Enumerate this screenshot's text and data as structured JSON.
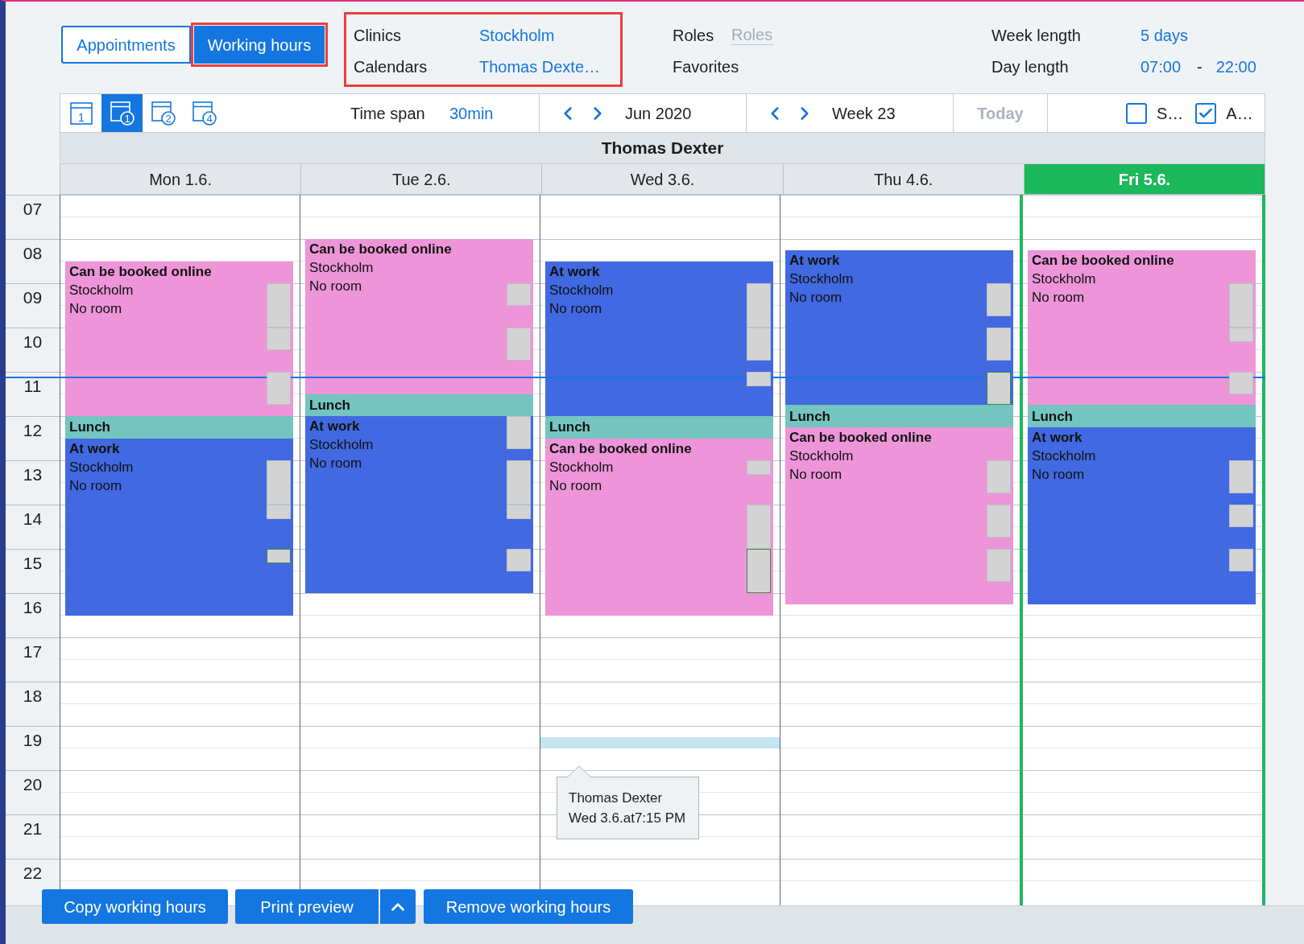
{
  "mode_tabs": [
    {
      "label": "Appointments",
      "selected": false,
      "highlighted": false
    },
    {
      "label": "Working hours",
      "selected": true,
      "highlighted": true
    }
  ],
  "filters": {
    "highlighted": true,
    "rows": [
      {
        "label": "Clinics",
        "value": "Stockholm"
      },
      {
        "label": "Calendars",
        "value": "Thomas Dexte…"
      }
    ]
  },
  "roles": {
    "label": "Roles",
    "placeholder": "Roles"
  },
  "favorites": {
    "label": "Favorites"
  },
  "week_length": {
    "label": "Week length",
    "value": "5 days"
  },
  "day_length": {
    "label": "Day length",
    "from": "07:00",
    "separator": "-",
    "to": "22:00"
  },
  "toolbar": {
    "view_buttons": [
      {
        "kind": "plain",
        "label": "1",
        "selected": false
      },
      {
        "kind": "badge",
        "label": "1",
        "selected": true
      },
      {
        "kind": "badge",
        "label": "2",
        "selected": false
      },
      {
        "kind": "badge",
        "label": "4",
        "selected": false
      }
    ],
    "time_span": {
      "label": "Time span",
      "value": "30min"
    },
    "month": "Jun 2020",
    "week": "Week 23",
    "today": {
      "label": "Today",
      "disabled": true
    },
    "checkboxes": [
      {
        "label": "S…",
        "checked": false
      },
      {
        "label": "A…",
        "checked": true
      }
    ]
  },
  "calendar": {
    "owner": "Thomas Dexter",
    "hours": [
      "07",
      "08",
      "09",
      "10",
      "11",
      "12",
      "13",
      "14",
      "15",
      "16",
      "17",
      "18",
      "19",
      "20",
      "21",
      "22"
    ],
    "days": [
      {
        "label": "Mon 1.6.",
        "selected": false,
        "events": [
          {
            "title": "Can be booked online",
            "location": "Stockholm",
            "room": "No room",
            "color": "#ed95d8",
            "slots": [
              {
                "selected": false
              },
              {
                "selected": false
              },
              {
                "selected": false
              }
            ]
          },
          {
            "title": "Lunch",
            "color": "#74c4c0"
          },
          {
            "title": "At work",
            "location": "Stockholm",
            "room": "No room",
            "color": "#4169e1",
            "slots": [
              {
                "selected": false
              },
              {
                "selected": false
              },
              {
                "selected": true
              }
            ]
          }
        ]
      },
      {
        "label": "Tue 2.6.",
        "selected": false,
        "events": [
          {
            "title": "Can be booked online",
            "location": "Stockholm",
            "room": "No room",
            "color": "#ed95d8",
            "slots": [
              {
                "selected": false
              },
              {
                "selected": false
              }
            ]
          },
          {
            "title": "Lunch",
            "color": "#74c4c0"
          },
          {
            "title": "At work",
            "location": "Stockholm",
            "room": "No room",
            "color": "#4169e1",
            "slots": [
              {
                "selected": false
              },
              {
                "selected": false
              },
              {
                "selected": false
              },
              {
                "selected": false
              }
            ]
          }
        ]
      },
      {
        "label": "Wed 3.6.",
        "selected": false,
        "tooltip": {
          "title": "Thomas Dexter",
          "time": "Wed 3.6.at7:15 PM"
        },
        "events": [
          {
            "title": "At work",
            "location": "Stockholm",
            "room": "No room",
            "color": "#4169e1",
            "slots": [
              {
                "selected": false
              },
              {
                "selected": false
              },
              {
                "selected": false
              }
            ]
          },
          {
            "title": "Lunch",
            "color": "#74c4c0"
          },
          {
            "title": "Can be booked online",
            "location": "Stockholm",
            "room": "No room",
            "color": "#ed95d8",
            "slots": [
              {
                "selected": false
              },
              {
                "selected": false
              },
              {
                "selected": true
              }
            ]
          }
        ]
      },
      {
        "label": "Thu 4.6.",
        "selected": false,
        "events": [
          {
            "title": "At work",
            "location": "Stockholm",
            "room": "No room",
            "color": "#4169e1",
            "slots": [
              {
                "selected": false
              },
              {
                "selected": false
              },
              {
                "selected": true
              }
            ]
          },
          {
            "title": "Lunch",
            "color": "#74c4c0"
          },
          {
            "title": "Can be booked online",
            "location": "Stockholm",
            "room": "No room",
            "color": "#ed95d8",
            "slots": [
              {
                "selected": false
              },
              {
                "selected": false
              },
              {
                "selected": false
              }
            ]
          }
        ]
      },
      {
        "label": "Fri 5.6.",
        "selected": true,
        "events": [
          {
            "title": "Can be booked online",
            "location": "Stockholm",
            "room": "No room",
            "color": "#ed95d8",
            "slots": [
              {
                "selected": false
              },
              {
                "selected": false
              },
              {
                "selected": false
              }
            ]
          },
          {
            "title": "Lunch",
            "color": "#74c4c0"
          },
          {
            "title": "At work",
            "location": "Stockholm",
            "room": "No room",
            "color": "#4169e1",
            "slots": [
              {
                "selected": false
              },
              {
                "selected": false
              },
              {
                "selected": false
              }
            ]
          }
        ]
      }
    ]
  },
  "buttons": [
    {
      "label": "Copy working hours",
      "kind": "plain"
    },
    {
      "label": "Print preview",
      "kind": "split"
    },
    {
      "label": "Remove working hours",
      "kind": "plain"
    }
  ]
}
